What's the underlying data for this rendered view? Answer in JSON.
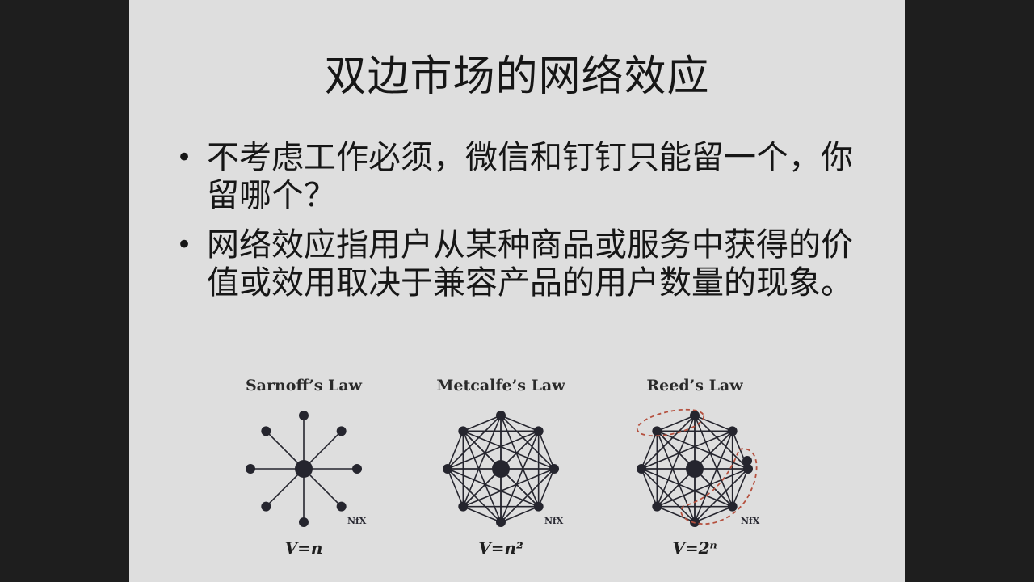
{
  "slide": {
    "title": "双边市场的网络效应",
    "bullets": [
      {
        "marker": "•",
        "text": "不考虑工作必须，微信和钉钉只能留一个，你留哪个？"
      },
      {
        "marker": "•",
        "text": "网络效应指用户从某种商品或服务中获得的价值或效用取决于兼容产品的用户数量的现象。"
      }
    ]
  },
  "figure": {
    "laws": [
      {
        "title": "Sarnoff’s Law",
        "formula": "V=n",
        "logo": "NfX"
      },
      {
        "title": "Metcalfe’s Law",
        "formula": "V=n²",
        "logo": "NfX"
      },
      {
        "title": "Reed’s Law",
        "formula": "V=2ⁿ",
        "logo": "NfX"
      }
    ],
    "colors": {
      "node": "#25252e",
      "edge": "#25252e",
      "group_outline": "#b5503e",
      "slide_bg": "#dedede",
      "frame_bg": "#1e1e1e"
    }
  }
}
